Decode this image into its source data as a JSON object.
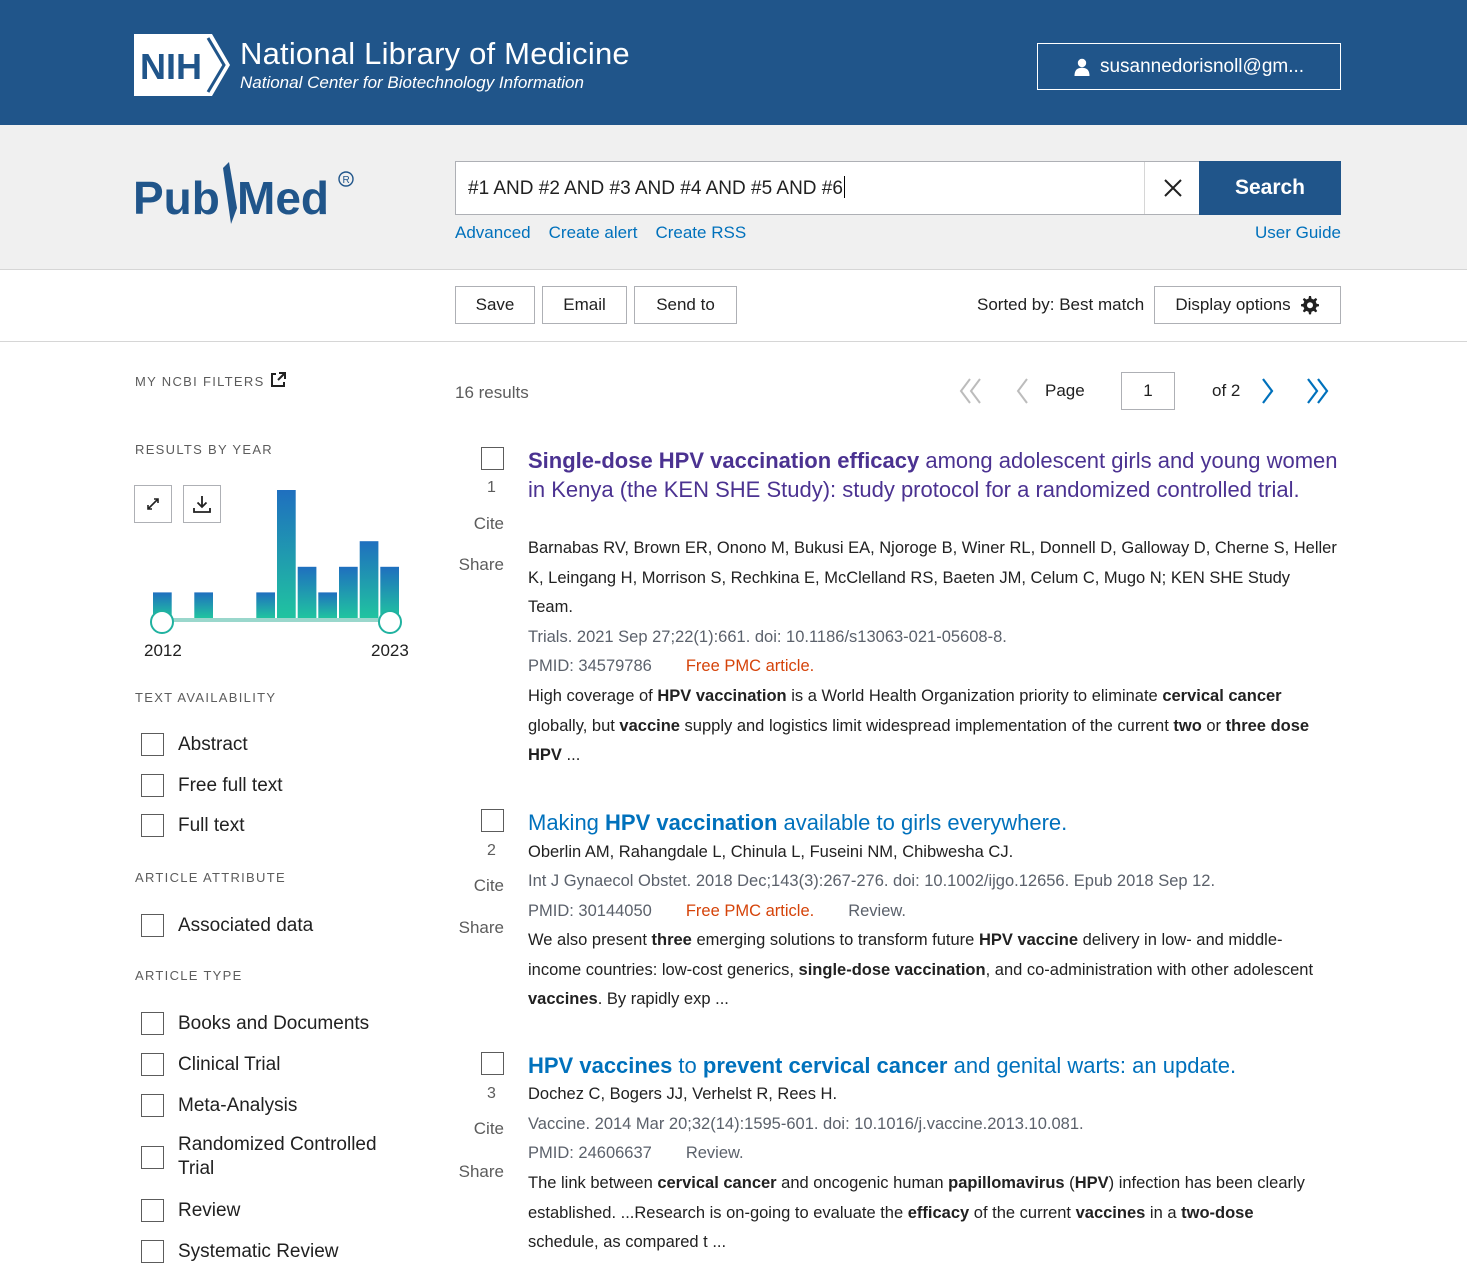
{
  "header": {
    "logo_text": "NIH",
    "title": "National Library of Medicine",
    "subtitle": "National Center for Biotechnology Information",
    "account_label": "susannedorisnoll@gm..."
  },
  "brand": {
    "name": "PubMed",
    "colors": {
      "nih_blue": "#20558a",
      "link": "#0071bc",
      "visited": "#4b3291",
      "free_article": "#d54309",
      "chart": "#20b2a0"
    }
  },
  "search": {
    "query": "#1 AND #2 AND #3 AND #4 AND #5 AND #6",
    "button_label": "Search",
    "links": [
      "Advanced",
      "Create alert",
      "Create RSS"
    ],
    "user_guide": "User Guide"
  },
  "toolbar": {
    "save": "Save",
    "email": "Email",
    "send_to": "Send to",
    "sorted_by": "Sorted by: Best match",
    "display_options": "Display options"
  },
  "sidebar": {
    "my_filters": "MY NCBI FILTERS",
    "results_by_year": "RESULTS BY YEAR",
    "year_start": "2012",
    "year_end": "2023",
    "text_availability": "TEXT AVAILABILITY",
    "text_options": [
      "Abstract",
      "Free full text",
      "Full text"
    ],
    "article_attribute": "ARTICLE ATTRIBUTE",
    "attribute_options": [
      "Associated data"
    ],
    "article_type": "ARTICLE TYPE",
    "type_options": [
      "Books and Documents",
      "Clinical Trial",
      "Meta-Analysis",
      "Randomized Controlled Trial",
      "Review",
      "Systematic Review"
    ]
  },
  "year_chart": {
    "years": [
      "2012",
      "2013",
      "2014",
      "2015",
      "2016",
      "2017",
      "2018",
      "2019",
      "2020",
      "2021",
      "2022",
      "2023"
    ],
    "counts": [
      1,
      0,
      1,
      0,
      0,
      1,
      5,
      2,
      1,
      2,
      3,
      2
    ]
  },
  "results": {
    "count": "16 results",
    "page_label": "Page",
    "page": "1",
    "of_pages": "of 2",
    "items": [
      {
        "num": "1",
        "cite": "Cite",
        "share": "Share",
        "title_parts": [
          {
            "text": "Single-dose HPV vaccination efficacy",
            "bold": true
          },
          {
            "text": " among adolescent girls and young women in Kenya (the KEN SHE Study): study protocol for a randomized controlled trial.",
            "bold": false
          }
        ],
        "authors": "Barnabas RV, Brown ER, Onono M, Bukusi EA, Njoroge B, Winer RL, Donnell D, Galloway D, Cherne S, Heller K, Leingang H, Morrison S, Rechkina E, McClelland RS, Baeten JM, Celum C, Mugo N; KEN SHE Study Team.",
        "citation": "Trials. 2021 Sep 27;22(1):661. doi: 10.1186/s13063-021-05608-8.",
        "pmid": "PMID: 34579786",
        "free": "Free PMC article.",
        "tag": "",
        "snippet_parts": [
          {
            "text": "High coverage of ",
            "bold": false
          },
          {
            "text": "HPV vaccination",
            "bold": true
          },
          {
            "text": " is a World Health Organization priority to eliminate ",
            "bold": false
          },
          {
            "text": "cervical cancer",
            "bold": true
          },
          {
            "text": " globally, but ",
            "bold": false
          },
          {
            "text": "vaccine",
            "bold": true
          },
          {
            "text": " supply and logistics limit widespread implementation of the current ",
            "bold": false
          },
          {
            "text": "two",
            "bold": true
          },
          {
            "text": " or ",
            "bold": false
          },
          {
            "text": "three dose HPV",
            "bold": true
          },
          {
            "text": " ...",
            "bold": false
          }
        ]
      },
      {
        "num": "2",
        "cite": "Cite",
        "share": "Share",
        "title_parts": [
          {
            "text": "Making ",
            "bold": false
          },
          {
            "text": "HPV vaccination",
            "bold": true
          },
          {
            "text": " available to girls everywhere.",
            "bold": false
          }
        ],
        "authors": "Oberlin AM, Rahangdale L, Chinula L, Fuseini NM, Chibwesha CJ.",
        "citation": "Int J Gynaecol Obstet. 2018 Dec;143(3):267-276. doi: 10.1002/ijgo.12656. Epub 2018 Sep 12.",
        "pmid": "PMID: 30144050",
        "free": "Free PMC article.",
        "tag": "Review.",
        "snippet_parts": [
          {
            "text": "We also present ",
            "bold": false
          },
          {
            "text": "three",
            "bold": true
          },
          {
            "text": " emerging solutions to transform future ",
            "bold": false
          },
          {
            "text": "HPV vaccine",
            "bold": true
          },
          {
            "text": " delivery in low- and middle-income countries: low-cost generics, ",
            "bold": false
          },
          {
            "text": "single-dose vaccination",
            "bold": true
          },
          {
            "text": ", and co-administration with other adolescent ",
            "bold": false
          },
          {
            "text": "vaccines",
            "bold": true
          },
          {
            "text": ". By rapidly exp ...",
            "bold": false
          }
        ]
      },
      {
        "num": "3",
        "cite": "Cite",
        "share": "Share",
        "title_parts": [
          {
            "text": "HPV vaccines",
            "bold": true
          },
          {
            "text": " to ",
            "bold": false
          },
          {
            "text": "prevent cervical cancer",
            "bold": true
          },
          {
            "text": " and genital warts: an update.",
            "bold": false
          }
        ],
        "authors": "Dochez C, Bogers JJ, Verhelst R, Rees H.",
        "citation": "Vaccine. 2014 Mar 20;32(14):1595-601. doi: 10.1016/j.vaccine.2013.10.081.",
        "pmid": "PMID: 24606637",
        "free": "",
        "tag": "Review.",
        "snippet_parts": [
          {
            "text": "The link between ",
            "bold": false
          },
          {
            "text": "cervical cancer",
            "bold": true
          },
          {
            "text": " and oncogenic human ",
            "bold": false
          },
          {
            "text": "papillomavirus",
            "bold": true
          },
          {
            "text": " (",
            "bold": false
          },
          {
            "text": "HPV",
            "bold": true
          },
          {
            "text": ") infection has been clearly established. ...Research is on-going to evaluate the ",
            "bold": false
          },
          {
            "text": "efficacy",
            "bold": true
          },
          {
            "text": " of the current ",
            "bold": false
          },
          {
            "text": "vaccines",
            "bold": true
          },
          {
            "text": " in a ",
            "bold": false
          },
          {
            "text": "two-dose",
            "bold": true
          },
          {
            "text": " schedule, as compared t ...",
            "bold": false
          }
        ]
      }
    ]
  }
}
